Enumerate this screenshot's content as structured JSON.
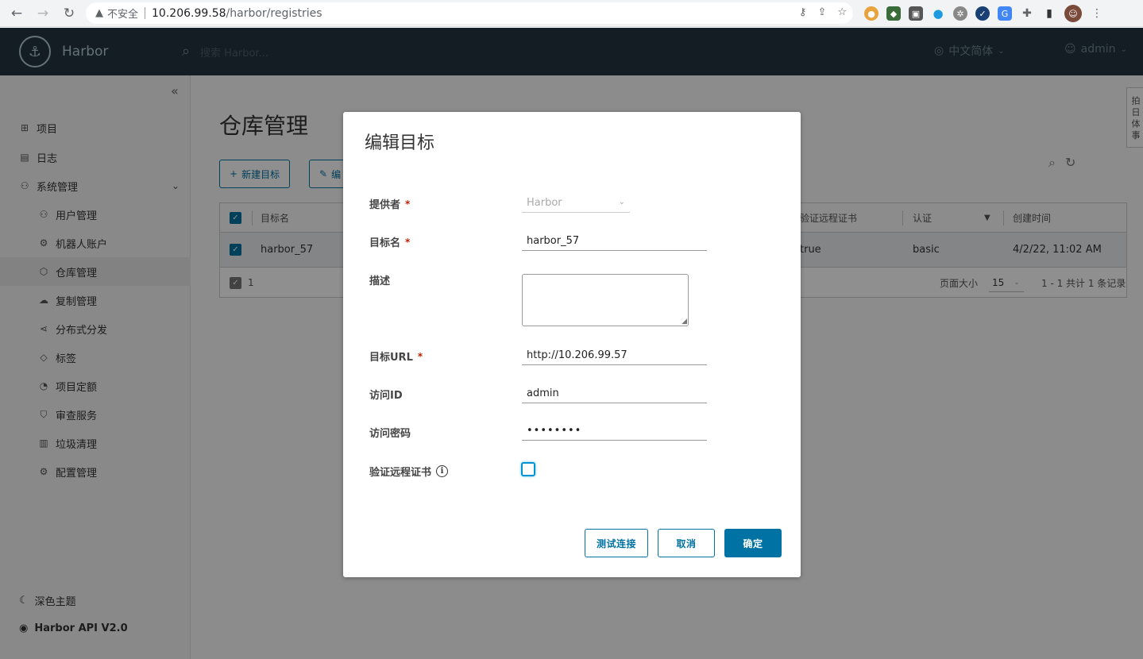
{
  "browser": {
    "insecure_label": "不安全",
    "url_host": "10.206.99.58",
    "url_path": "/harbor/registries"
  },
  "header": {
    "brand": "Harbor",
    "search_placeholder": "搜索 Harbor...",
    "language": "中文简体",
    "user": "admin"
  },
  "sidebar": {
    "items": [
      {
        "label": "项目",
        "icon": "projects-icon"
      },
      {
        "label": "日志",
        "icon": "logs-icon"
      },
      {
        "label": "系统管理",
        "icon": "administration-icon"
      }
    ],
    "sub_items": [
      {
        "label": "用户管理",
        "icon": "users-icon"
      },
      {
        "label": "机器人账户",
        "icon": "robot-icon"
      },
      {
        "label": "仓库管理",
        "icon": "registries-icon"
      },
      {
        "label": "复制管理",
        "icon": "replications-icon"
      },
      {
        "label": "分布式分发",
        "icon": "distribution-icon"
      },
      {
        "label": "标签",
        "icon": "labels-icon"
      },
      {
        "label": "项目定额",
        "icon": "quotas-icon"
      },
      {
        "label": "审查服务",
        "icon": "scanners-icon"
      },
      {
        "label": "垃圾清理",
        "icon": "gc-icon"
      },
      {
        "label": "配置管理",
        "icon": "config-icon"
      }
    ],
    "dark_theme": "深色主题",
    "api_link": "Harbor API V2.0"
  },
  "main": {
    "title": "仓库管理",
    "new_button": "新建目标",
    "edit_button": "编",
    "columns": [
      "目标名",
      "验证远程证书",
      "认证",
      "创建时间"
    ],
    "row": {
      "name": "harbor_57",
      "verify": "true",
      "auth": "basic",
      "created": "4/2/22, 11:02 AM"
    },
    "selected_count": "1",
    "page_size_label": "页面大小",
    "page_size": "15",
    "pagination": "1 - 1 共计 1 条记录"
  },
  "side_tab": "拍 日 体 事",
  "modal": {
    "title": "编辑目标",
    "provider_label": "提供者",
    "provider_value": "Harbor",
    "name_label": "目标名",
    "name_value": "harbor_57",
    "desc_label": "描述",
    "url_label": "目标URL",
    "url_value": "http://10.206.99.57",
    "access_id_label": "访问ID",
    "access_id_value": "admin",
    "secret_label": "访问密码",
    "secret_value": "••••••••",
    "verify_label": "验证远程证书",
    "required_mark": "*",
    "test_button": "测试连接",
    "cancel_button": "取消",
    "ok_button": "确定"
  }
}
